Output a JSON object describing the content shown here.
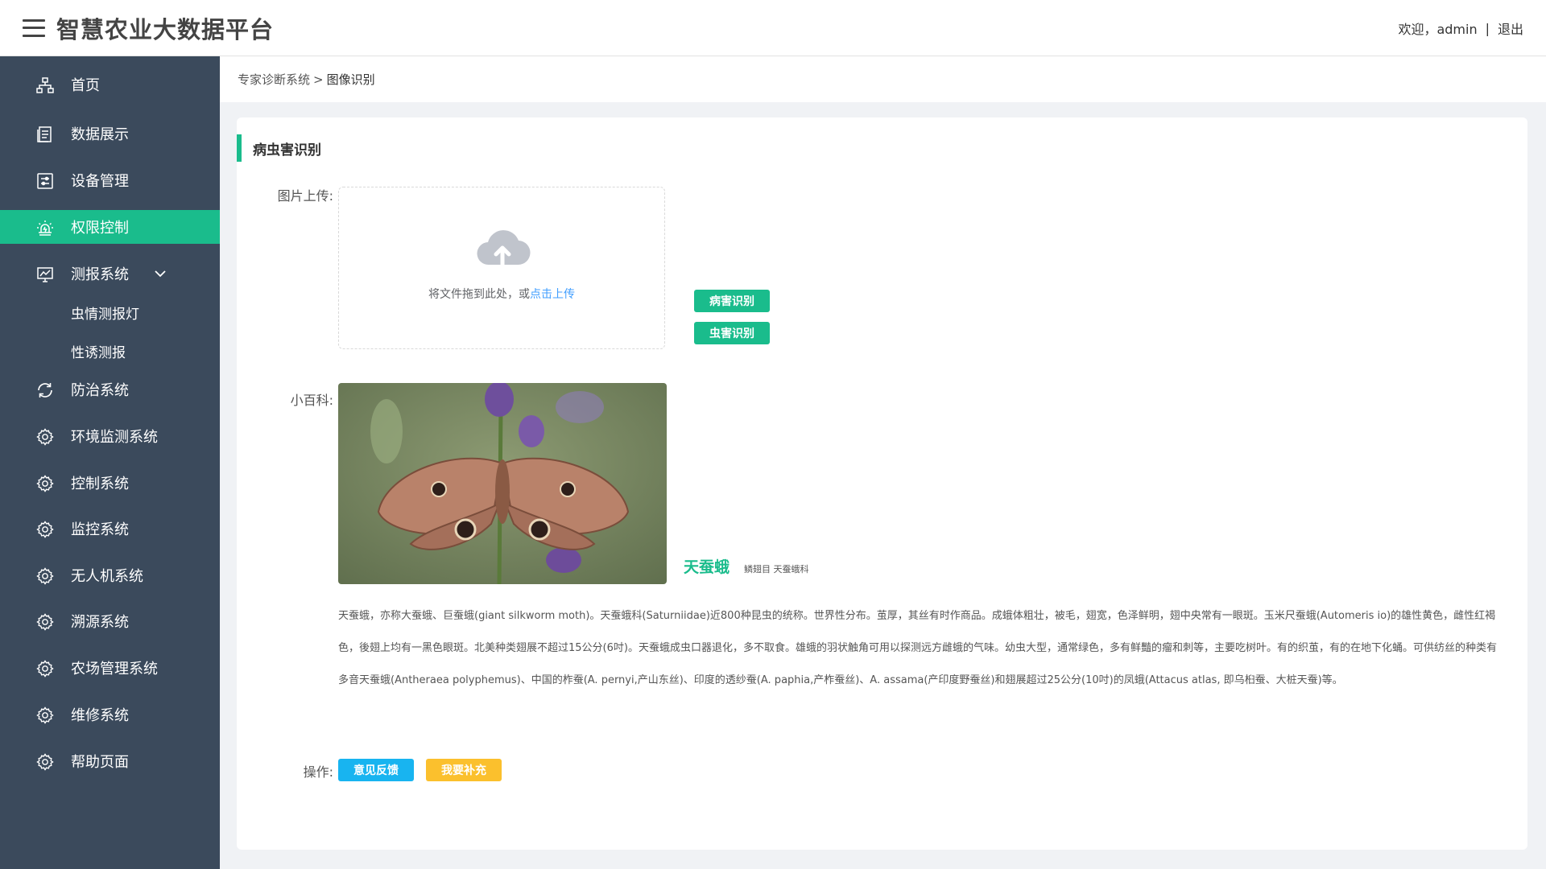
{
  "header": {
    "title": "智慧农业大数据平台",
    "welcome": "欢迎，admin",
    "separator": "|",
    "logout": "退出"
  },
  "sidebar": {
    "items": [
      {
        "label": "首页",
        "icon": "sitemap-icon"
      },
      {
        "label": "数据展示",
        "icon": "document-icon"
      },
      {
        "label": "设备管理",
        "icon": "sliders-icon"
      },
      {
        "label": "权限控制",
        "icon": "alarm-icon",
        "active": true
      },
      {
        "label": "测报系统",
        "icon": "monitor-chart-icon",
        "expanded": true
      },
      {
        "label": "防治系统",
        "icon": "refresh-icon"
      },
      {
        "label": "环境监测系统",
        "icon": "gear-icon"
      },
      {
        "label": "控制系统",
        "icon": "gear-icon"
      },
      {
        "label": "监控系统",
        "icon": "gear-icon"
      },
      {
        "label": "无人机系统",
        "icon": "gear-icon"
      },
      {
        "label": "溯源系统",
        "icon": "gear-icon"
      },
      {
        "label": "农场管理系统",
        "icon": "gear-icon"
      },
      {
        "label": "维修系统",
        "icon": "gear-icon"
      },
      {
        "label": "帮助页面",
        "icon": "gear-icon"
      }
    ],
    "subitems": [
      {
        "label": "虫情测报灯"
      },
      {
        "label": "性诱测报"
      }
    ]
  },
  "breadcrumb": {
    "parent": "专家诊断系统",
    "sep": ">",
    "current": "图像识别"
  },
  "main": {
    "section_title": "病虫害识别",
    "upload_label": "图片上传:",
    "upload_text": "将文件拖到此处，或",
    "upload_link": "点击上传",
    "btn_disease": "病害识别",
    "btn_pest": "虫害识别",
    "encyclopedia_label": "小百科:",
    "species_name": "天蚕蛾",
    "species_taxonomy": "鳞翅目 天蚕蛾科",
    "description": "天蚕蛾，亦称大蚕蛾、巨蚕蛾(giant silkworm moth)。天蚕蛾科(Saturniidae)近800种昆虫的统称。世界性分布。茧厚，其丝有时作商品。成蛾体粗壮，被毛，翅宽，色泽鲜明，翅中央常有一眼斑。玉米尺蚕蛾(Automeris io)的雄性黄色，雌性红褐色，後翅上均有一黑色眼斑。北美种类翅展不超过15公分(6吋)。天蚕蛾成虫口器退化，多不取食。雄蛾的羽状触角可用以探测远方雌蛾的气味。幼虫大型，通常绿色，多有鲜豔的瘤和刺等，主要吃树叶。有的织茧，有的在地下化蛹。可供纺丝的种类有多音天蚕蛾(Antheraea polyphemus)、中国的柞蚕(A. pernyi,产山东丝)、印度的透纱蚕(A. paphia,产柞蚕丝)、A. assama(产印度野蚕丝)和翅展超过25公分(10吋)的凤蛾(Attacus atlas, 即乌桕蚕、大桩天蚕)等。",
    "actions_label": "操作:",
    "btn_feedback": "意见反馈",
    "btn_supplement": "我要补充"
  },
  "colors": {
    "accent": "#1abc8c",
    "sidebar_bg": "#3b4a5c",
    "link": "#409eff",
    "feedback": "#18b4f0",
    "supplement": "#fbc02d"
  }
}
